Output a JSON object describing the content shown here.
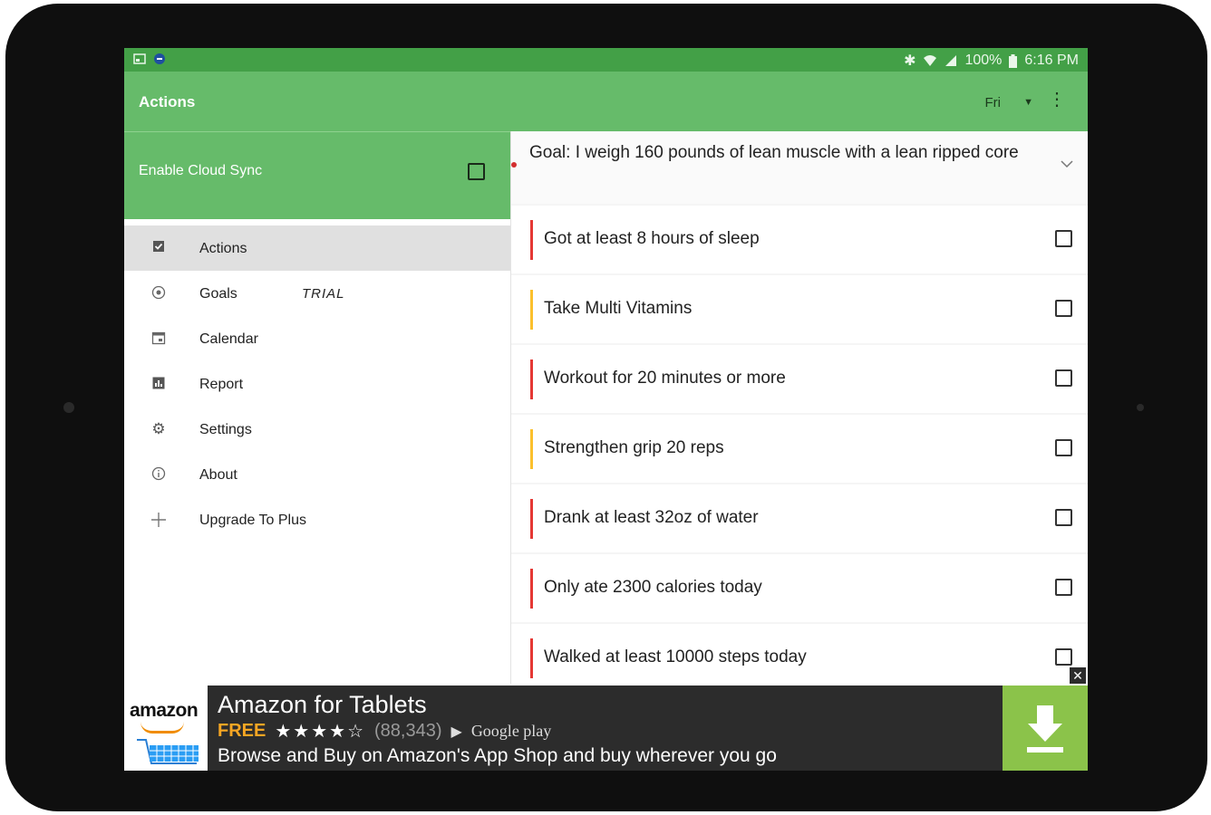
{
  "status_bar": {
    "battery": "100%",
    "time": "6:16 PM"
  },
  "app_bar": {
    "title": "Actions",
    "day": "Fri"
  },
  "drawer": {
    "cloud_sync_label": "Enable Cloud Sync",
    "items": [
      {
        "label": "Actions",
        "icon": "check-box-icon",
        "active": true
      },
      {
        "label": "Goals",
        "icon": "target-icon",
        "badge": "TRIAL"
      },
      {
        "label": "Calendar",
        "icon": "calendar-icon"
      },
      {
        "label": "Report",
        "icon": "report-icon"
      },
      {
        "label": "Settings",
        "icon": "gear-icon"
      },
      {
        "label": "About",
        "icon": "info-icon"
      },
      {
        "label": "Upgrade To Plus",
        "icon": "plus-icon"
      }
    ]
  },
  "goal": {
    "text": "Goal: I weigh 160 pounds of lean muscle with a lean ripped core"
  },
  "actions": [
    {
      "label": "Got at least 8 hours of sleep",
      "color": "#e53935"
    },
    {
      "label": "Take Multi Vitamins",
      "color": "#fbc02d"
    },
    {
      "label": "Workout for 20 minutes or more",
      "color": "#e53935"
    },
    {
      "label": "Strengthen grip 20 reps",
      "color": "#fbc02d"
    },
    {
      "label": "Drank at least 32oz of water",
      "color": "#e53935"
    },
    {
      "label": "Only ate 2300 calories today",
      "color": "#e53935"
    },
    {
      "label": "Walked at least 10000 steps today",
      "color": "#e53935"
    }
  ],
  "ad": {
    "brand": "amazon",
    "headline": "Amazon for Tablets",
    "price": "FREE",
    "stars": "★★★★☆",
    "rating_count": "(88,343)",
    "store": "Google play",
    "description": "Browse and Buy on Amazon's App Shop and buy wherever you go"
  },
  "colors": {
    "status_bar": "#43a047",
    "app_bar": "#66bb6a",
    "ad_install": "#8bc34a"
  }
}
